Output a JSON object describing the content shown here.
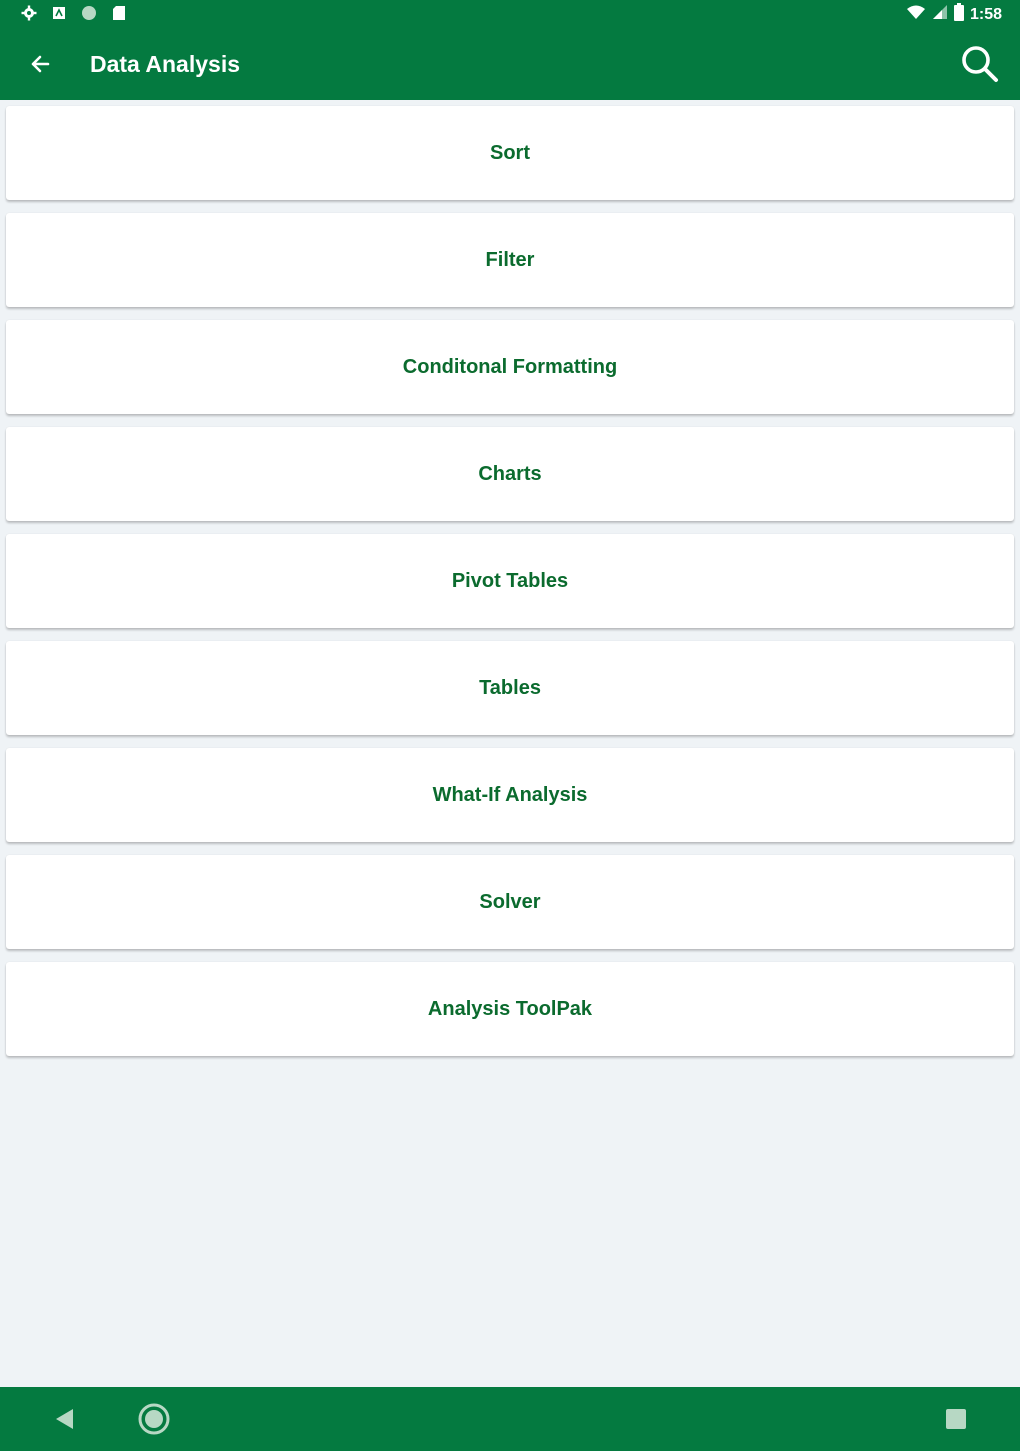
{
  "status_bar": {
    "time": "1:58",
    "left_icons": [
      "settings-icon",
      "notification-icon",
      "circle-icon",
      "sd-card-icon"
    ],
    "right_icons": [
      "wifi-icon",
      "signal-icon",
      "battery-icon"
    ]
  },
  "app_bar": {
    "title": "Data Analysis",
    "back_icon": "arrow-left-icon",
    "search_icon": "search-icon"
  },
  "menu": {
    "items": [
      {
        "label": "Sort"
      },
      {
        "label": "Filter"
      },
      {
        "label": "Conditonal Formatting"
      },
      {
        "label": "Charts"
      },
      {
        "label": "Pivot Tables"
      },
      {
        "label": "Tables"
      },
      {
        "label": "What-If Analysis"
      },
      {
        "label": "Solver"
      },
      {
        "label": "Analysis ToolPak"
      }
    ]
  },
  "nav_bar": {
    "icons": [
      "back-triangle-icon",
      "home-circle-icon",
      "recents-square-icon"
    ]
  },
  "colors": {
    "primary": "#047a40",
    "item_text": "#0b6b2e",
    "background": "#eff3f6",
    "card": "#ffffff"
  }
}
